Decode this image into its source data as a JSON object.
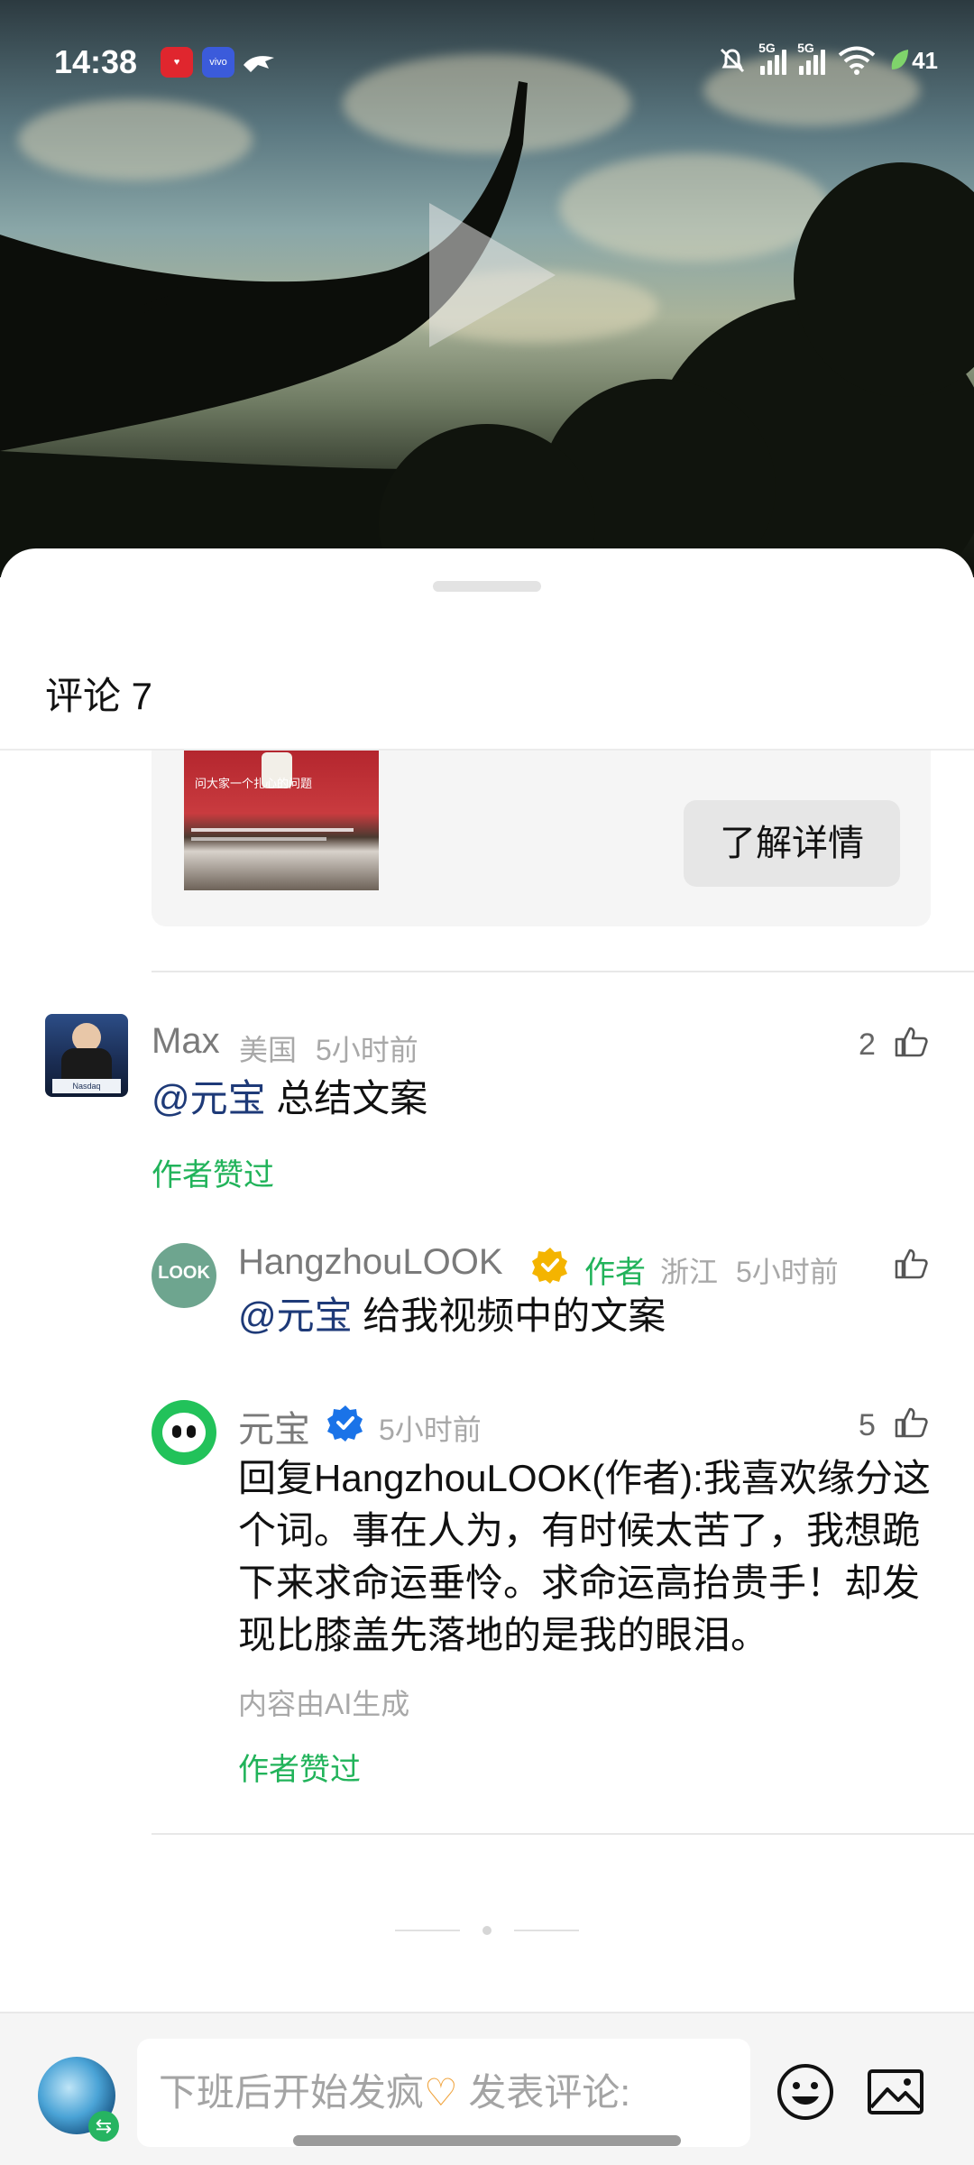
{
  "status_bar": {
    "time": "14:38",
    "battery": "41",
    "network_1": "5G",
    "network_2": "5G",
    "app_icon_2_label": "vivo"
  },
  "sheet": {
    "title": "评论 7"
  },
  "ad": {
    "thumb_caption": "问大家一个扎心的问题",
    "button_label": "了解详情"
  },
  "comments": [
    {
      "name": "Max",
      "location": "美国",
      "time": "5小时前",
      "like_count": "2",
      "mention": "@元宝",
      "text": " 总结文案",
      "author_liked": "作者赞过"
    },
    {
      "name": "HangzhouLOOK",
      "author_tag": "作者",
      "location": "浙江",
      "time": "5小时前",
      "mention": "@元宝",
      "text": " 给我视频中的文案"
    },
    {
      "name": "元宝",
      "time": "5小时前",
      "like_count": "5",
      "text": "回复HangzhouLOOK(作者):我喜欢缘分这个词。事在人为，有时候太苦了，我想跪下来求命运垂怜。求命运高抬贵手！却发现比膝盖先落地的是我的眼泪。",
      "ai_note": "内容由AI生成",
      "author_liked": "作者赞过"
    }
  ],
  "input_bar": {
    "placeholder_part1": "下班后开始发疯",
    "placeholder_heart": "♡",
    "placeholder_part2": " 发表评论:"
  },
  "colors": {
    "mention": "#1e3a78",
    "author_green": "#21b35a",
    "verified_orange": "#f4b400",
    "verified_blue": "#1a73e8"
  }
}
